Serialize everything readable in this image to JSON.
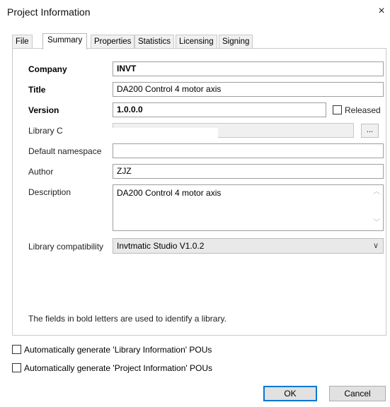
{
  "window": {
    "title": "Project Information",
    "close_glyph": "×"
  },
  "tabs": [
    {
      "label": "File",
      "active": false
    },
    {
      "label": "Summary",
      "active": true
    },
    {
      "label": "Properties",
      "active": false
    },
    {
      "label": "Statistics",
      "active": false
    },
    {
      "label": "Licensing",
      "active": false
    },
    {
      "label": "Signing",
      "active": false
    }
  ],
  "summary": {
    "company_label": "Company",
    "company_value": "INVT",
    "title_label": "Title",
    "title_value": "DA200 Control 4 motor axis",
    "version_label": "Version",
    "version_value": "1.0.0.0",
    "released_label": "Released",
    "released_checked": false,
    "library_categories_label": "Library C",
    "library_categories_value": "",
    "browse_label": "...",
    "default_namespace_label": "Default namespace",
    "default_namespace_value": "",
    "author_label": "Author",
    "author_value": "ZJZ",
    "description_label": "Description",
    "description_value": "DA200 Control 4 motor axis",
    "library_compat_label": "Library compatibility",
    "library_compat_value": "Invtmatic Studio V1.0.2",
    "bold_note": "The fields in bold letters are used to identify a library."
  },
  "options": {
    "auto_library_info": "Automatically generate 'Library Information' POUs",
    "auto_project_info": "Automatically generate 'Project Information' POUs"
  },
  "buttons": {
    "ok": "OK",
    "cancel": "Cancel"
  }
}
